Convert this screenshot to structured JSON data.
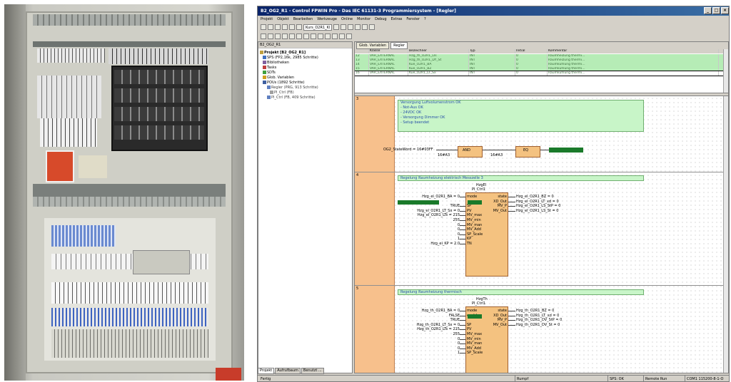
{
  "window": {
    "title": "B2_OG2_R1 - Control FPWIN Pro - Das IEC 61131-3 Programmiersystem - [Regler]",
    "controls": [
      "_",
      "□",
      "×"
    ]
  },
  "menu": [
    "Projekt",
    "Objekt",
    "Bearbeiten",
    "Werkzeuge",
    "Online",
    "Monitor",
    "Debug",
    "Extras",
    "Fenster",
    "?"
  ],
  "toolbar": {
    "pou_select": "Kurs_O2R1_Kl"
  },
  "project_tree": {
    "header": "B2_OG2_R1",
    "items": [
      {
        "label": "Projekt [B2_OG2_R1]",
        "bold": true
      },
      {
        "label": "SPS (FP2,16k, 2985 Schritte)"
      },
      {
        "label": "Bibliotheken"
      },
      {
        "label": "Tasks"
      },
      {
        "label": "SDTs"
      },
      {
        "label": "Glob. Variablen"
      },
      {
        "label": "POUs (1892 Schritte)"
      },
      {
        "label": "Regler (PRG, 913 Schritte)"
      },
      {
        "label": "PI_Ctrl (FB)"
      },
      {
        "label": "PI_Ctrl (FB, 409 Schritte)"
      }
    ],
    "tabs": [
      "Projekt",
      "Aufrufbaum",
      "Benutzt ..."
    ]
  },
  "editor_tabs": [
    "Glob. Variablen",
    "Regler"
  ],
  "var_table": {
    "headers": [
      "",
      "Klasse",
      "Bezeichner",
      "Typ",
      "Initial",
      "Kommentar"
    ],
    "rows": [
      [
        "12",
        "VAR_EXTERNAL",
        "Hzg_th_O2R1_LTs",
        "INT",
        "0",
        "Raumheizung thermi..."
      ],
      [
        "13",
        "VAR_EXTERNAL",
        "Hzg_th_O2R1_DY_St",
        "INT",
        "0",
        "Raumheizung thermi..."
      ],
      [
        "14",
        "VAR_EXTERNAL",
        "Kue_O2R1_BA",
        "INT",
        "0",
        "Raumkühlung thermi..."
      ],
      [
        "15",
        "VAR_EXTERNAL",
        "Kue_O2R1_BZ",
        "INT",
        "0",
        "Raumkühlung thermi..."
      ],
      [
        "16",
        "VAR_EXTERNAL",
        "Kue_O2R1_LT_Sx",
        "INT",
        "0",
        "Raumkühlung thermi..."
      ]
    ]
  },
  "networks": {
    "n3": {
      "number": "3",
      "comment": [
        "Versorgung Luftvolumenstrom OK",
        "- Not-Aus OK",
        "- 24VDC OK",
        "- Versorgung Dimmer OK",
        "- Setup beendet"
      ],
      "input": "OG2_StateWord = 16#03FF",
      "and_label": "AND",
      "and_const": "16#A3",
      "eq_label": "EQ",
      "eq_const": "16#A3"
    },
    "n4": {
      "number": "4",
      "comment": "Regelung Raumheizung elektrisch Messzelle 3",
      "instance": "HzgEl",
      "fbtype": "PI_Ctrl1",
      "in_names": [
        "mode",
        "",
        "SP",
        "PV",
        "MV_max",
        "MV_min",
        "MV_man",
        "MV_Add",
        "SP_Scale",
        "KP",
        "TN"
      ],
      "out_names": [
        "state",
        "XD_Out",
        "MV_P",
        "MV_Out"
      ],
      "in_vals": [
        "Hzg_el_O2R1_BA = 0",
        "",
        "TRUE",
        "Hzg_el_O2R1_LT_Sx = 0",
        "Hzg_el_O2R1_LTs = 215",
        "255",
        "0",
        "0",
        "0",
        "1",
        "Hzg_el_KP = 2.0",
        "Hzg_el_TN = 300.0"
      ],
      "out_vals": [
        "Hzg_el_O2R1_BZ = 0",
        "Hzg_el_O2R1_LT_xd = 0",
        "Hzg_el_O2R1_LS_StP = 0",
        "Hzg_el_O2R1_LS_St = 0"
      ]
    },
    "n5": {
      "number": "5",
      "comment": "Regelung Raumheizung thermisch",
      "instance": "HzgTh",
      "fbtype": "PI_Ctrl1",
      "in_names": [
        "mode",
        "enable",
        "",
        "SP",
        "PV",
        "MV_max",
        "MV_min",
        "MV_man",
        "MV_Add",
        "SP_Scale"
      ],
      "out_names": [
        "state",
        "XD_Out",
        "MV_P",
        "MV_Out"
      ],
      "in_vals": [
        "Hzg_th_O2R1_BA = 0",
        "FALSE",
        "TRUE",
        "Hzg_th_O2R1_LT_Sx = 0",
        "Hzg_th_O2R1_LTs = 215",
        "255",
        "0",
        "0",
        "0",
        "1"
      ],
      "out_vals": [
        "Hzg_th_O2R1_BZ = 0",
        "Hzg_th_O2R1_LT_xd = 0",
        "Hzg_th_O2R1_DV_StP = 0",
        "Hzg_th_O2R1_DV_St = 0"
      ]
    }
  },
  "status": {
    "left": "Fertig",
    "mode": "Rumpf",
    "plc": "SPS: OK",
    "run": "Remote Run",
    "com": "COM1 115200-8-1-O"
  },
  "colors": {
    "network_band": "#f7c08c",
    "comment_bg": "#c8f5c8",
    "fb_block": "#f4c280",
    "highlight_green": "#1a7a2a"
  }
}
